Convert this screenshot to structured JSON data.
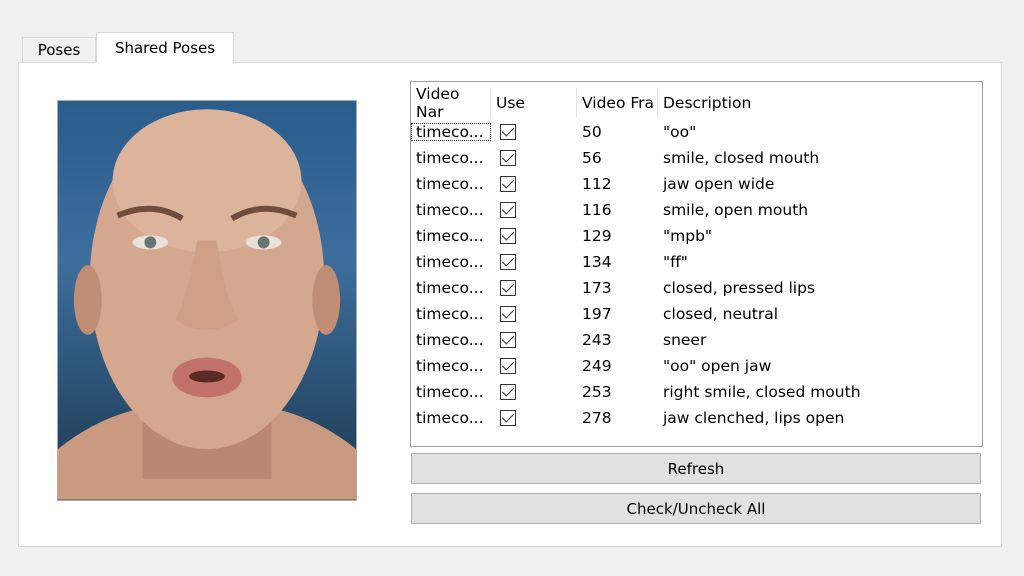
{
  "tabs": [
    {
      "label": "Poses"
    },
    {
      "label": "Shared Poses"
    }
  ],
  "list": {
    "columns": [
      "Video Nar",
      "Use",
      "Video Fra",
      "Description"
    ],
    "rows": [
      {
        "name": "timeco...",
        "use": true,
        "frame": "50",
        "desc": "\"oo\""
      },
      {
        "name": "timeco...",
        "use": true,
        "frame": "56",
        "desc": "smile, closed mouth"
      },
      {
        "name": "timeco...",
        "use": true,
        "frame": "112",
        "desc": "jaw open wide"
      },
      {
        "name": "timeco...",
        "use": true,
        "frame": "116",
        "desc": "smile, open mouth"
      },
      {
        "name": "timeco...",
        "use": true,
        "frame": "129",
        "desc": "\"mpb\""
      },
      {
        "name": "timeco...",
        "use": true,
        "frame": "134",
        "desc": "\"ff\""
      },
      {
        "name": "timeco...",
        "use": true,
        "frame": "173",
        "desc": "closed, pressed lips"
      },
      {
        "name": "timeco...",
        "use": true,
        "frame": "197",
        "desc": "closed, neutral"
      },
      {
        "name": "timeco...",
        "use": true,
        "frame": "243",
        "desc": "sneer"
      },
      {
        "name": "timeco...",
        "use": true,
        "frame": "249",
        "desc": "\"oo\" open jaw"
      },
      {
        "name": "timeco...",
        "use": true,
        "frame": "253",
        "desc": "right smile, closed mouth"
      },
      {
        "name": "timeco...",
        "use": true,
        "frame": "278",
        "desc": "jaw clenched, lips open"
      }
    ]
  },
  "buttons": {
    "refresh": "Refresh",
    "check_all": "Check/Uncheck All"
  }
}
